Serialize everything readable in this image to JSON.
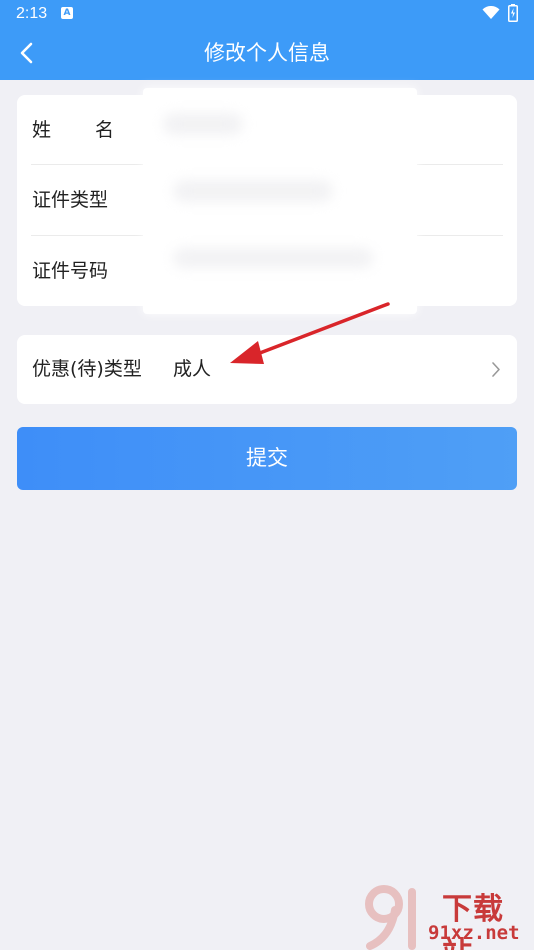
{
  "status_bar": {
    "time": "2:13",
    "app_icon_letter": "A"
  },
  "header": {
    "title": "修改个人信息"
  },
  "info_card": {
    "rows": [
      {
        "label_chars": [
          "姓",
          "名"
        ]
      },
      {
        "label": "证件类型"
      },
      {
        "label": "证件号码"
      }
    ]
  },
  "discount": {
    "label": "优惠(待)类型",
    "value": "成人"
  },
  "submit": {
    "label": "提交"
  },
  "watermark": {
    "text": "下载站",
    "url": "91xz.net"
  },
  "colors": {
    "primary": "#3d9bf8",
    "background": "#f0f0f5",
    "arrow": "#d9252a",
    "watermark": "#c83a3a"
  }
}
